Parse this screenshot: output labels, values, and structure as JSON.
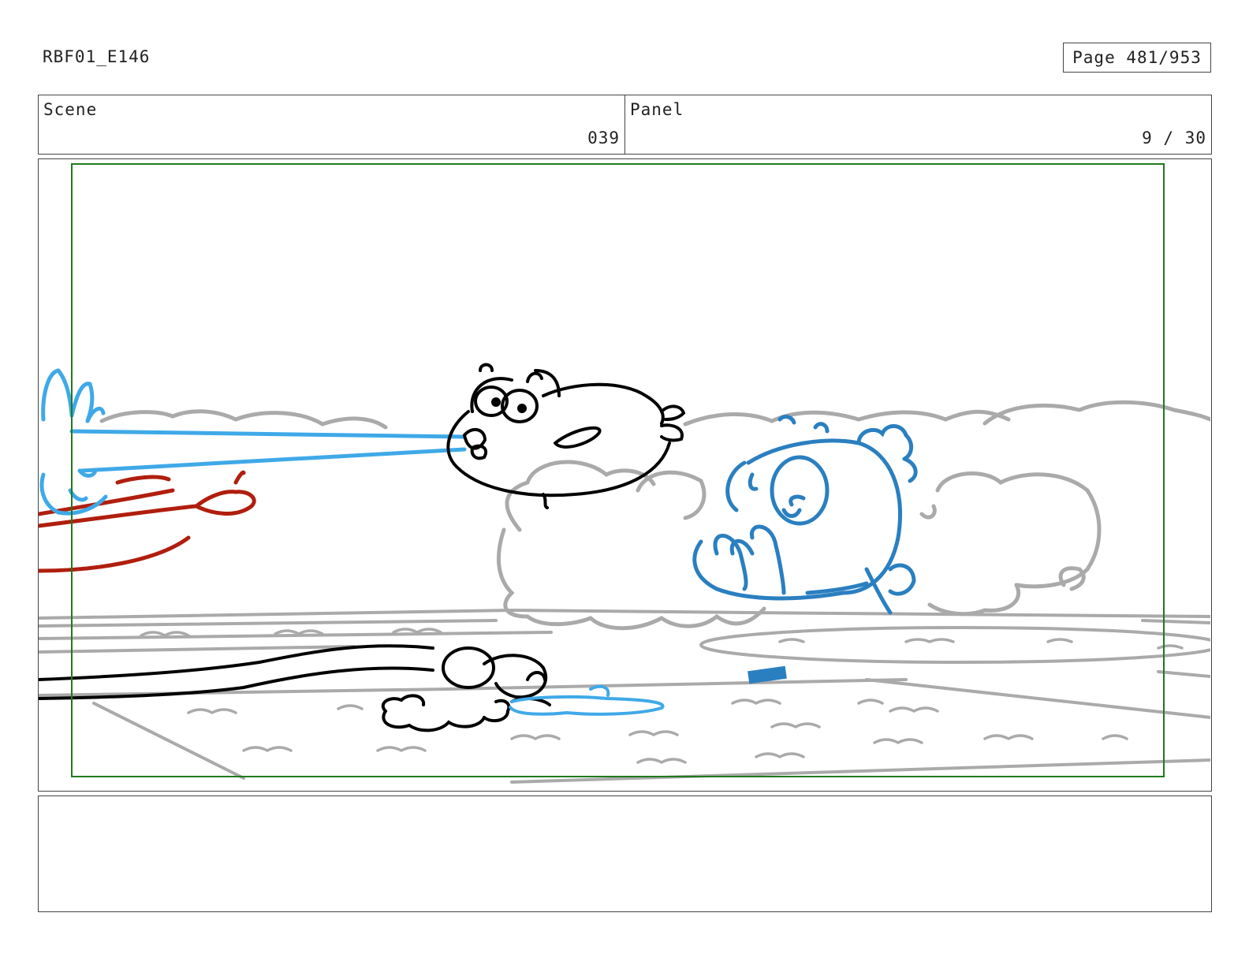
{
  "header": {
    "doc_id": "RBF01_E146",
    "page_label": "Page 481/953"
  },
  "info": {
    "scene_label": "Scene",
    "scene_value": "039",
    "panel_label": "Panel",
    "panel_value": "9 / 30"
  },
  "colors": {
    "frame_line": "#444444",
    "safe_area": "#1f7a1f",
    "sketch_gray": "#aaaaaa",
    "character_black": "#000000",
    "beam_blue": "#3fa9e8",
    "character_blue": "#2a7fc0",
    "character_red": "#b01e0e"
  },
  "notes": {
    "text": ""
  }
}
